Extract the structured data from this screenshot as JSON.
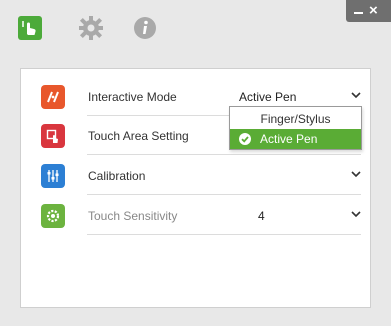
{
  "toolbar": {
    "icons": [
      "touch-hand-icon",
      "gear-icon",
      "info-icon"
    ]
  },
  "window": {
    "minimize_label": "_",
    "close_label": "×"
  },
  "settings": {
    "rows": [
      {
        "label": "Interactive Mode",
        "value": "Active Pen",
        "icon": "pen-touch-icon",
        "icon_color": "#e8572c"
      },
      {
        "label": "Touch Area Setting",
        "value": "",
        "icon": "touch-area-icon",
        "icon_color": "#d9363e"
      },
      {
        "label": "Calibration",
        "value": "",
        "icon": "sliders-icon",
        "icon_color": "#2c7fd4"
      },
      {
        "label": "Touch Sensitivity",
        "value": "4",
        "icon": "gear-hand-icon",
        "icon_color": "#6cb33f"
      }
    ]
  },
  "dropdown": {
    "options": [
      "Finger/Stylus",
      "Active Pen"
    ],
    "selected": "Active Pen",
    "selected_color": "#5aac35"
  }
}
